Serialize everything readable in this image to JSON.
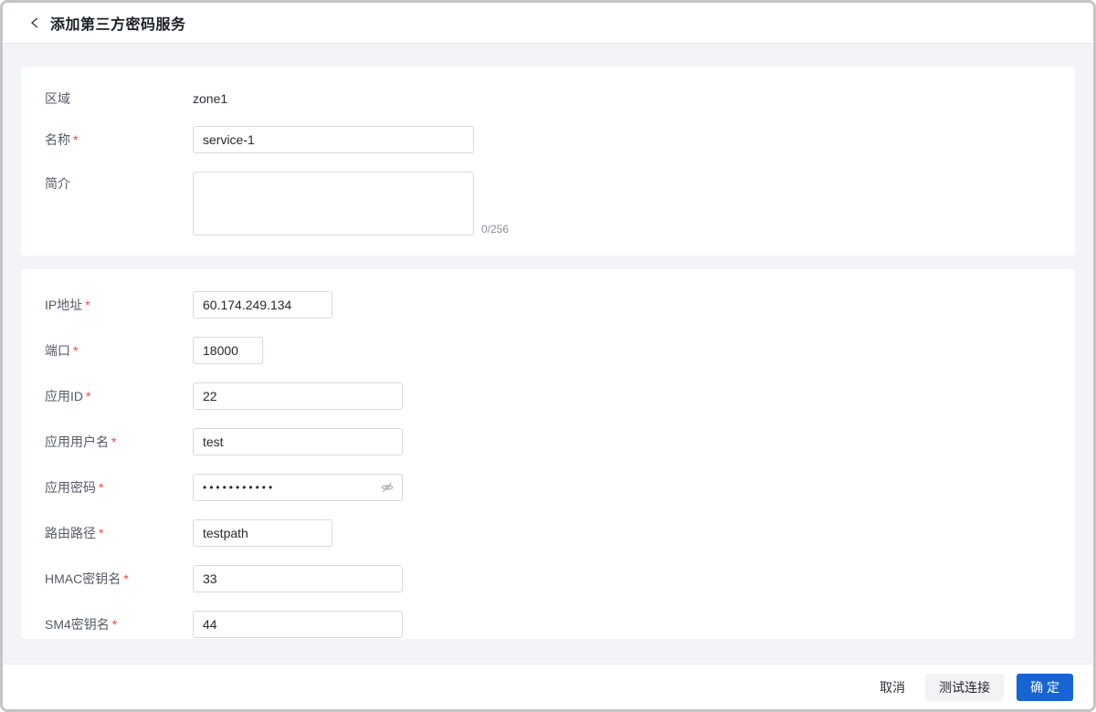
{
  "meta": {
    "required_mark": "*"
  },
  "header": {
    "title": "添加第三方密码服务"
  },
  "form": {
    "zone": {
      "label": "区域",
      "value": "zone1"
    },
    "name": {
      "label": "名称",
      "value": "service-1",
      "required": true
    },
    "desc": {
      "label": "简介",
      "value": "",
      "counter": "0/256"
    },
    "ip": {
      "label": "IP地址",
      "value": "60.174.249.134",
      "required": true
    },
    "port": {
      "label": "端口",
      "value": "18000",
      "required": true
    },
    "app_id": {
      "label": "应用ID",
      "value": "22",
      "required": true
    },
    "app_username": {
      "label": "应用用户名",
      "value": "test",
      "required": true
    },
    "app_password": {
      "label": "应用密码",
      "value": "•••••••••••",
      "masked": true,
      "eye_icon": "eye-invisible-icon",
      "required": true
    },
    "route_path": {
      "label": "路由路径",
      "value": "testpath",
      "required": true
    },
    "hmac_key": {
      "label": "HMAC密钥名",
      "value": "33",
      "required": true
    },
    "sm4_key": {
      "label": "SM4密钥名",
      "value": "44",
      "required": true
    }
  },
  "footer": {
    "cancel_label": "取消",
    "test_label": "测试连接",
    "confirm_label": "确 定"
  },
  "colors": {
    "primary": "#1765d2",
    "required": "#f2483d",
    "page_bg": "#f2f4f8",
    "card_bg": "#ffffff"
  }
}
